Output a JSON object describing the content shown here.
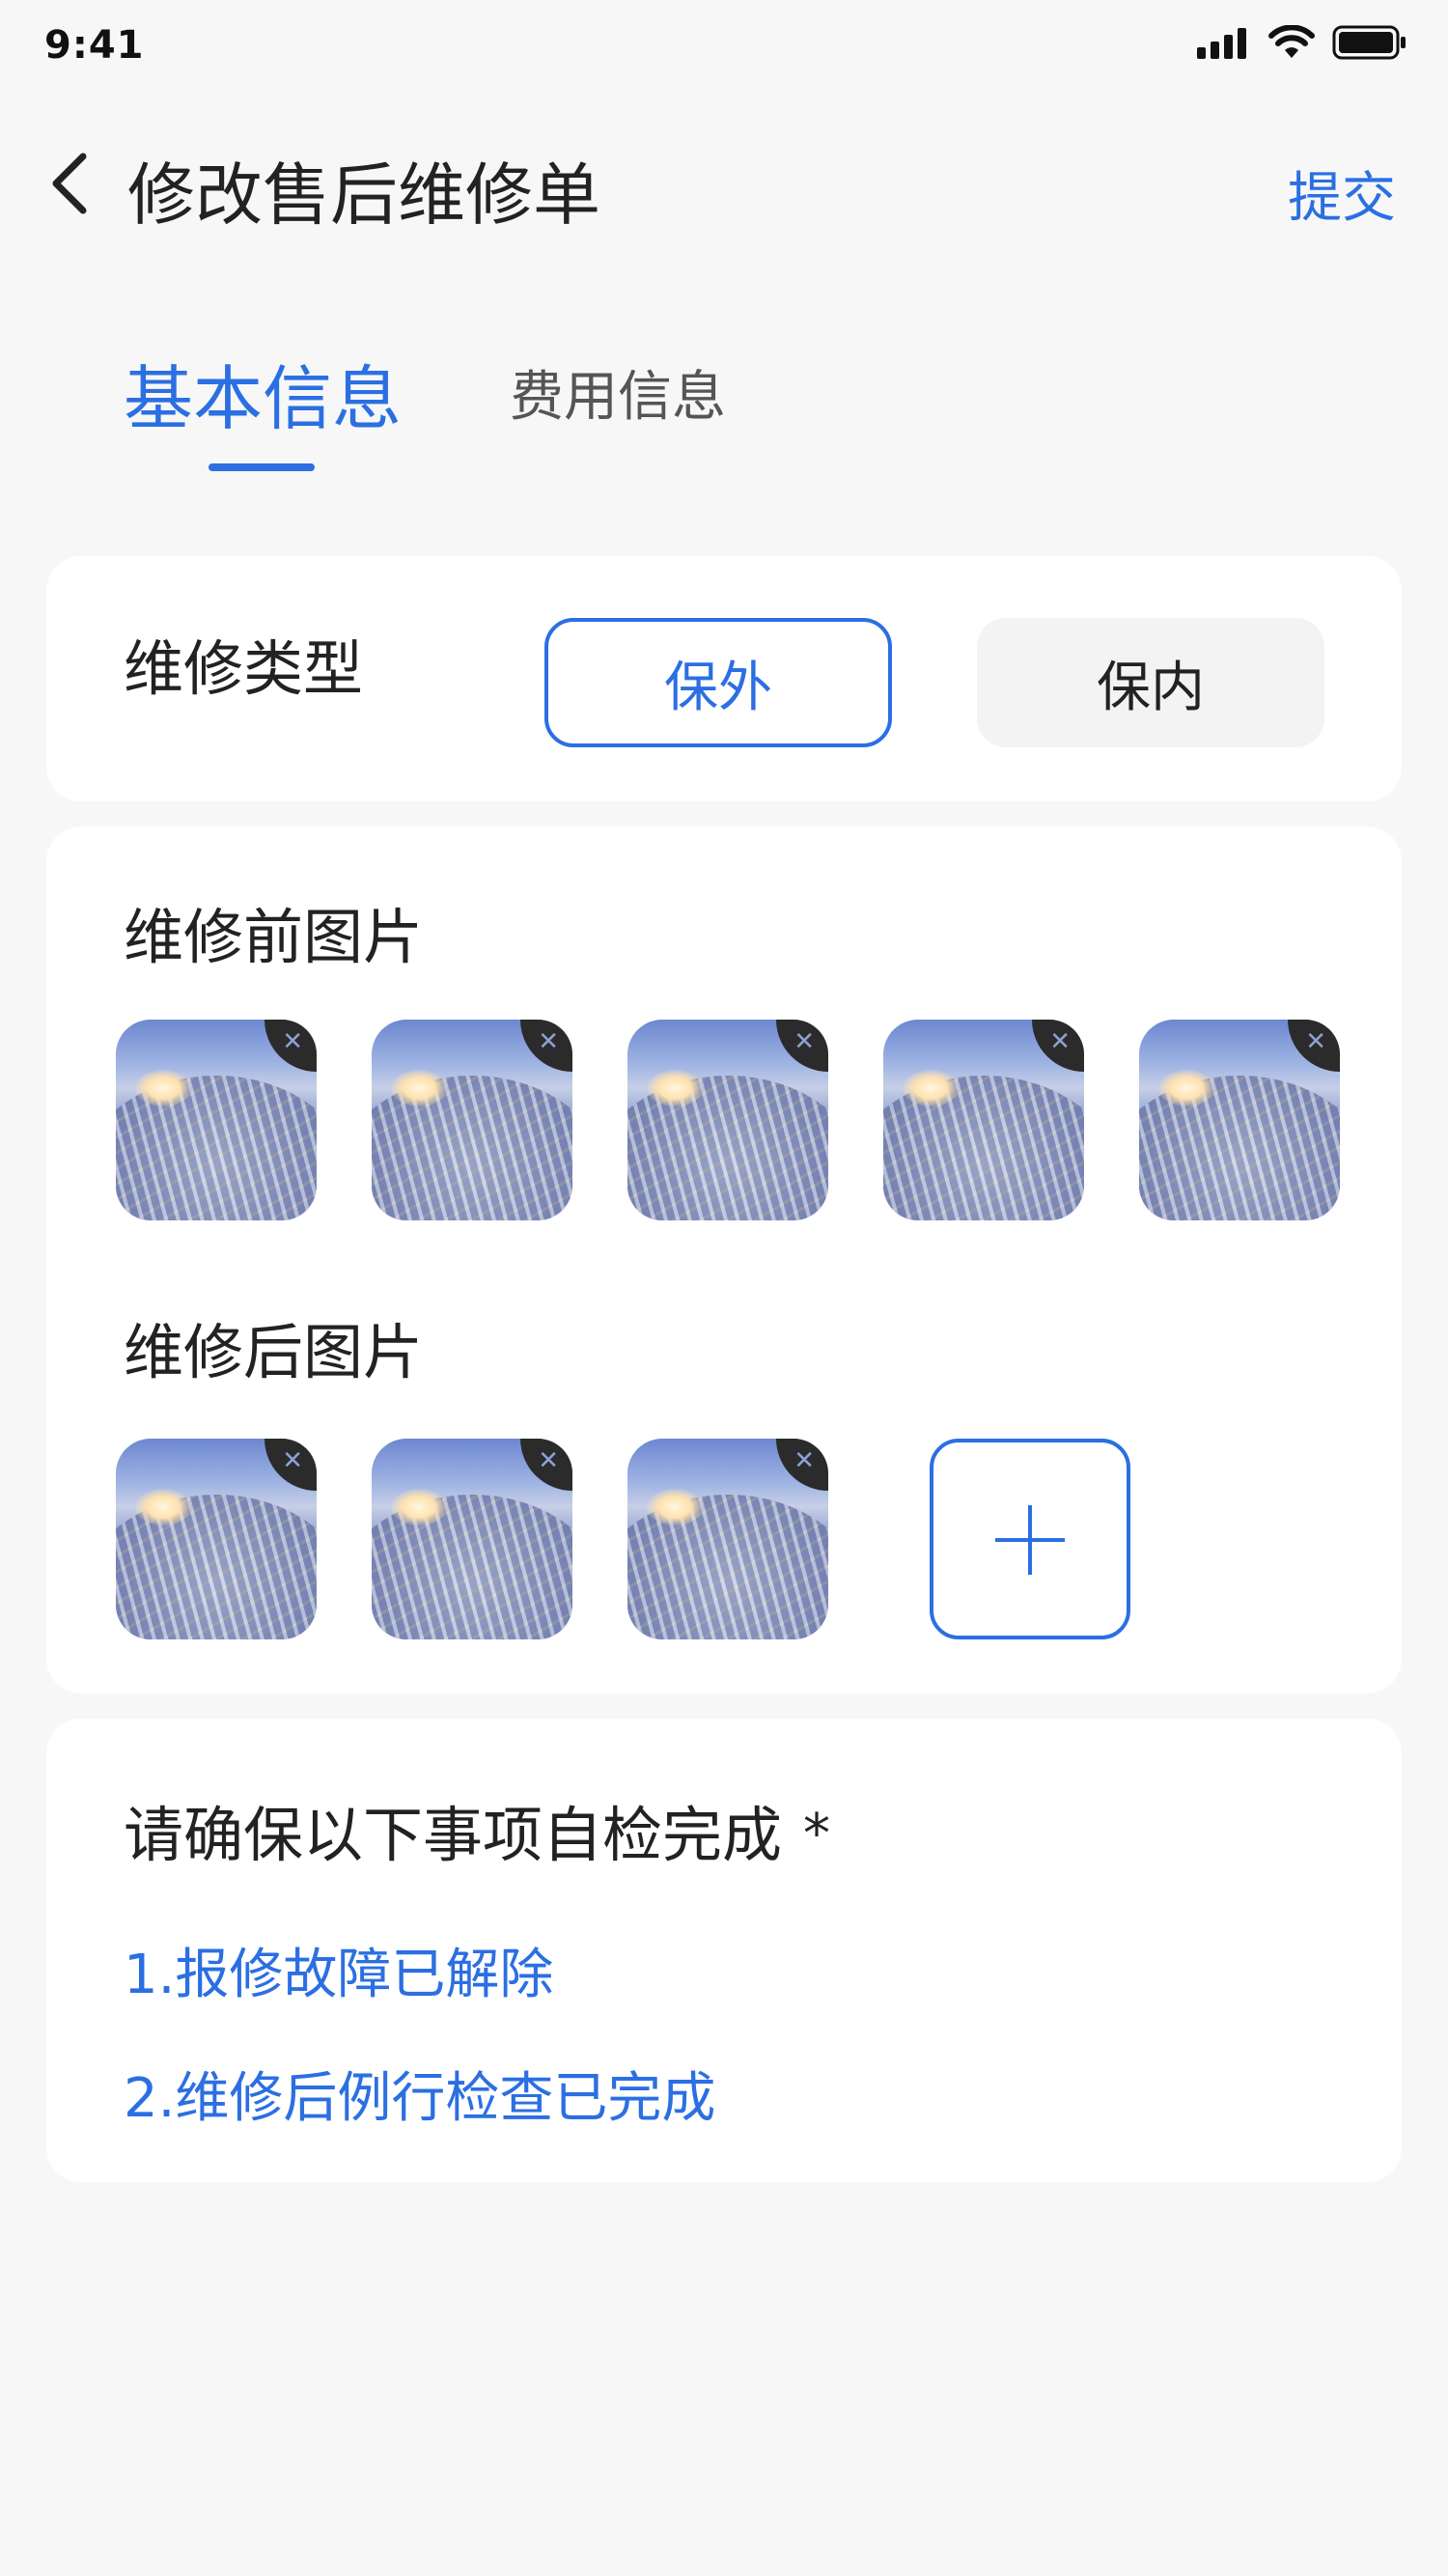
{
  "status_bar": {
    "time": "9:41"
  },
  "header": {
    "title": "修改售后维修单",
    "submit_label": "提交"
  },
  "tabs": [
    {
      "label": "基本信息",
      "active": true
    },
    {
      "label": "费用信息",
      "active": false
    }
  ],
  "repair_type": {
    "label": "维修类型",
    "options": [
      "保外",
      "保内"
    ],
    "selected": "保外"
  },
  "before_photos": {
    "label": "维修前图片",
    "count": 5
  },
  "after_photos": {
    "label": "维修后图片",
    "count": 3
  },
  "self_check": {
    "title": "请确保以下事项自检完成",
    "required_mark": "*",
    "items": [
      "1.报修故障已解除",
      "2.维修后例行检查已完成"
    ]
  },
  "colors": {
    "accent": "#2b6fe2",
    "background": "#f7f7f7",
    "card": "#ffffff"
  }
}
